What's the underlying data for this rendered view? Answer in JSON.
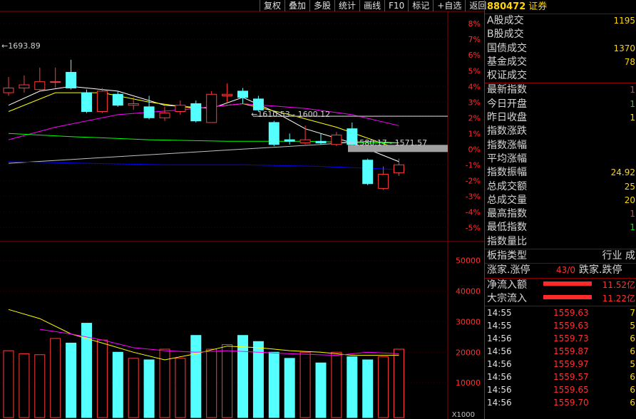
{
  "toolbar": [
    "复权",
    "叠加",
    "多股",
    "统计",
    "画线",
    "F10",
    "标记",
    "+自选",
    "返回"
  ],
  "colors": {
    "up": "#ff3b3b",
    "down": "#54ffff",
    "ma5": "#ffffff",
    "ma10": "#ffff00",
    "ma20": "#ff00ff",
    "ma60": "#00ff00",
    "ma120": "#c0c0c0",
    "ma250": "#0000ff",
    "vol_ma5": "#ffff00",
    "vol_ma10": "#ff00ff"
  },
  "chart_data": [
    {
      "type": "candlestick",
      "title": "",
      "y_right_ticks": [
        "8%",
        "7%",
        "6%",
        "5%",
        "4%",
        "3%",
        "2%",
        "1%",
        "0%",
        "-1%",
        "-2%",
        "-3%",
        "-4%",
        "-5%"
      ],
      "ylim_pct": [
        -5.8,
        8.6
      ],
      "candles": [
        {
          "o": 3.6,
          "c": 3.9,
          "h": 4.6,
          "l": 3.4
        },
        {
          "o": 3.9,
          "c": 4.1,
          "h": 4.7,
          "l": 3.6
        },
        {
          "o": 3.8,
          "c": 4.3,
          "h": 5.2,
          "l": 3.7
        },
        {
          "o": 4.3,
          "c": 4.3,
          "h": 5.2,
          "l": 3.9
        },
        {
          "o": 4.9,
          "c": 3.9,
          "h": 5.7,
          "l": 3.8
        },
        {
          "o": 3.6,
          "c": 2.4,
          "h": 3.8,
          "l": 2.3
        },
        {
          "o": 2.4,
          "c": 3.7,
          "h": 3.9,
          "l": 2.3
        },
        {
          "o": 3.5,
          "c": 2.8,
          "h": 3.7,
          "l": 2.7
        },
        {
          "o": 2.8,
          "c": 2.9,
          "h": 3.3,
          "l": 2.5
        },
        {
          "o": 2.7,
          "c": 2.0,
          "h": 3.4,
          "l": 1.9
        },
        {
          "o": 2.0,
          "c": 2.3,
          "h": 2.7,
          "l": 1.8
        },
        {
          "o": 2.4,
          "c": 2.8,
          "h": 3.1,
          "l": 2.2
        },
        {
          "o": 2.9,
          "c": 1.8,
          "h": 3.1,
          "l": 1.7
        },
        {
          "o": 1.7,
          "c": 3.5,
          "h": 3.7,
          "l": 1.7
        },
        {
          "o": 3.4,
          "c": 3.5,
          "h": 4.2,
          "l": 3.0
        },
        {
          "o": 3.7,
          "c": 3.3,
          "h": 3.9,
          "l": 2.9
        },
        {
          "o": 3.2,
          "c": 2.5,
          "h": 3.4,
          "l": 2.4
        },
        {
          "o": 1.7,
          "c": 0.3,
          "h": 1.8,
          "l": 0.2
        },
        {
          "o": 0.6,
          "c": 0.5,
          "h": 1.0,
          "l": 0.3
        },
        {
          "o": 0.4,
          "c": 0.6,
          "h": 1.5,
          "l": 0.3
        },
        {
          "o": 0.5,
          "c": 0.4,
          "h": 1.0,
          "l": 0.3
        },
        {
          "o": 0.3,
          "c": 0.9,
          "h": 1.1,
          "l": 0.2
        },
        {
          "o": 1.3,
          "c": 0.3,
          "h": 1.7,
          "l": 0.2
        },
        {
          "o": -0.7,
          "c": -2.2,
          "h": -0.6,
          "l": -2.3
        },
        {
          "o": -2.5,
          "c": -1.6,
          "h": -1.1,
          "l": -2.6
        },
        {
          "o": -1.5,
          "c": -1.0,
          "h": -0.6,
          "l": -1.7
        }
      ],
      "ma": [
        {
          "key": "ma5",
          "pts": [
            [
              0,
              2.8
            ],
            [
              2,
              3.7
            ],
            [
              4,
              4.0
            ],
            [
              7,
              3.7
            ],
            [
              10,
              2.8
            ],
            [
              13,
              2.6
            ],
            [
              15,
              3.3
            ],
            [
              17,
              2.4
            ],
            [
              19,
              1.3
            ],
            [
              22,
              0.4
            ],
            [
              25,
              -0.8
            ]
          ]
        },
        {
          "key": "ma10",
          "pts": [
            [
              0,
              2.4
            ],
            [
              3,
              3.6
            ],
            [
              6,
              3.6
            ],
            [
              9,
              3.0
            ],
            [
              12,
              2.6
            ],
            [
              15,
              2.9
            ],
            [
              18,
              2.2
            ],
            [
              21,
              1.4
            ],
            [
              25,
              0.0
            ]
          ]
        },
        {
          "key": "ma20",
          "pts": [
            [
              0,
              0.6
            ],
            [
              3,
              1.4
            ],
            [
              7,
              2.2
            ],
            [
              11,
              2.5
            ],
            [
              15,
              2.9
            ],
            [
              19,
              2.6
            ],
            [
              22,
              2.2
            ],
            [
              25,
              1.5
            ]
          ]
        },
        {
          "key": "ma60",
          "pts": [
            [
              0,
              1.0
            ],
            [
              4,
              0.8
            ],
            [
              9,
              0.6
            ],
            [
              14,
              0.5
            ],
            [
              19,
              0.5
            ],
            [
              23,
              0.4
            ],
            [
              25,
              0.4
            ]
          ]
        },
        {
          "key": "ma120",
          "pts": [
            [
              0,
              -0.9
            ],
            [
              5,
              -0.6
            ],
            [
              10,
              -0.3
            ],
            [
              15,
              0.0
            ],
            [
              20,
              0.3
            ],
            [
              23,
              0.5
            ],
            [
              25,
              0.4
            ]
          ]
        },
        {
          "key": "ma250",
          "pts": [
            [
              0,
              -0.8
            ],
            [
              5,
              -0.9
            ],
            [
              10,
              -1.0
            ],
            [
              15,
              -1.0
            ],
            [
              20,
              -1.1
            ],
            [
              25,
              -1.3
            ]
          ]
        }
      ],
      "annotations": [
        "1693.89",
        "1610.53 - 1600.12",
        "1580.17 - 1571.57"
      ],
      "hlines_pct": [
        2.1,
        0.0
      ],
      "volume": {
        "y_ticks": [
          "50000",
          "40000",
          "30000",
          "20000",
          "10000"
        ],
        "ylim": [
          0,
          56000
        ],
        "unit_label": "X1000",
        "bars": [
          20500,
          19500,
          19200,
          24500,
          23000,
          29500,
          24000,
          20000,
          18000,
          17500,
          21000,
          18000,
          25500,
          21000,
          22500,
          25500,
          23500,
          20000,
          18000,
          20000,
          16500,
          20000,
          18500,
          17500,
          18500,
          21000
        ],
        "ma5": [
          [
            0,
            34000
          ],
          [
            2,
            31000
          ],
          [
            4,
            26000
          ],
          [
            6,
            23000
          ],
          [
            8,
            20000
          ],
          [
            10,
            17500
          ],
          [
            12,
            19500
          ],
          [
            14,
            22000
          ],
          [
            16,
            21500
          ],
          [
            18,
            20500
          ],
          [
            20,
            20000
          ],
          [
            22,
            19000
          ],
          [
            25,
            19000
          ]
        ],
        "ma10": [
          [
            2,
            27500
          ],
          [
            4,
            26000
          ],
          [
            6,
            24000
          ],
          [
            8,
            21500
          ],
          [
            10,
            20500
          ],
          [
            12,
            20000
          ],
          [
            14,
            20500
          ],
          [
            16,
            20000
          ],
          [
            18,
            19500
          ],
          [
            21,
            19000
          ],
          [
            23,
            20000
          ],
          [
            25,
            19500
          ]
        ]
      }
    }
  ],
  "panel": {
    "code": "880472",
    "name": "证券",
    "rows": [
      {
        "label": "A股成交",
        "value": "1195",
        "cls": ""
      },
      {
        "label": "B股成交",
        "value": "",
        "cls": ""
      },
      {
        "label": "国债成交",
        "value": "1370",
        "cls": ""
      },
      {
        "label": "基金成交",
        "value": "78",
        "cls": ""
      },
      {
        "label": "权证成交",
        "value": "",
        "cls": ""
      }
    ],
    "rows2": [
      {
        "label": "最新指数",
        "value": "1",
        "cls": "red"
      },
      {
        "label": "今日开盘",
        "value": "1",
        "cls": "grn"
      },
      {
        "label": "昨日收盘",
        "value": "1",
        "cls": ""
      },
      {
        "label": "指数涨跌",
        "value": "",
        "cls": ""
      },
      {
        "label": "指数涨幅",
        "value": "",
        "cls": ""
      },
      {
        "label": "平均涨幅",
        "value": "",
        "cls": ""
      },
      {
        "label": "指数振幅",
        "value": "24.92",
        "cls": ""
      },
      {
        "label": "总成交额",
        "value": "25",
        "cls": ""
      },
      {
        "label": "总成交量",
        "value": "20",
        "cls": ""
      },
      {
        "label": "最高指数",
        "value": "1",
        "cls": "red"
      },
      {
        "label": "最低指数",
        "value": "1",
        "cls": "grn"
      },
      {
        "label": "指数量比",
        "value": "",
        "cls": ""
      }
    ],
    "sector_label": "板指类型",
    "sector_value": "行业 成",
    "up_label": "涨家.涨停",
    "up_value": "43/0",
    "down_label": "跌家.跌停",
    "inflow_label": "净流入额",
    "inflow_value": "11.52亿",
    "block_label": "大宗流入",
    "block_value": "11.22亿",
    "ticks": [
      {
        "t": "14:55",
        "p": "1559.63",
        "v": "7"
      },
      {
        "t": "14:55",
        "p": "1559.63",
        "v": "5"
      },
      {
        "t": "14:56",
        "p": "1559.73",
        "v": "6"
      },
      {
        "t": "14:56",
        "p": "1559.87",
        "v": "6"
      },
      {
        "t": "14:56",
        "p": "1559.97",
        "v": "5"
      },
      {
        "t": "14:56",
        "p": "1559.57",
        "v": "6"
      },
      {
        "t": "14:56",
        "p": "1559.65",
        "v": "6"
      },
      {
        "t": "14:56",
        "p": "1559.70",
        "v": "6"
      }
    ]
  }
}
